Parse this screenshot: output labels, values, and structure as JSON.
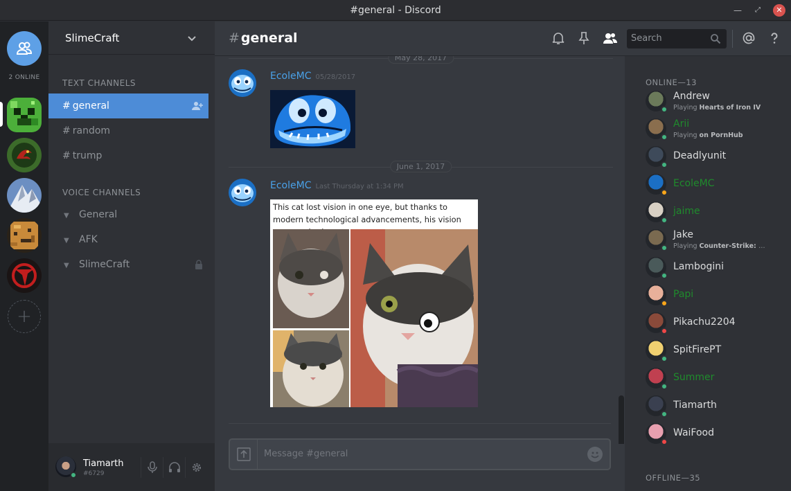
{
  "window": {
    "title": "#general - Discord"
  },
  "rail": {
    "online_label": "2 ONLINE",
    "guilds": [
      "SlimeCraft",
      "dragon-server",
      "mountain-server",
      "cookie-server",
      "red-server"
    ]
  },
  "guild": {
    "name": "SlimeCraft"
  },
  "text_category": "TEXT CHANNELS",
  "text_channels": [
    {
      "label": "general"
    },
    {
      "label": "random"
    },
    {
      "label": "trump"
    }
  ],
  "voice_category": "VOICE CHANNELS",
  "voice_channels": [
    {
      "label": "General"
    },
    {
      "label": "AFK"
    },
    {
      "label": "SlimeCraft"
    }
  ],
  "user": {
    "name": "Tiamarth",
    "tag": "#6729"
  },
  "chat": {
    "channel": "general",
    "search_placeholder": "Search",
    "divider_top": "May 28, 2017",
    "divider_mid": "June 1, 2017",
    "messages": [
      {
        "author": "EcoleMC",
        "time": "05/28/2017"
      },
      {
        "author": "EcoleMC",
        "time": "Last Thursday at 1:34 PM",
        "caption": "This cat lost vision in one eye, but thanks to modern technological advancements, his vision was repaired."
      }
    ],
    "composer_placeholder": "Message #general"
  },
  "members": {
    "online_label": "ONLINE—13",
    "offline_label": "OFFLINE—35",
    "list": [
      {
        "name": "Andrew",
        "playing_prefix": "Playing",
        "playing": "Hearts of Iron IV",
        "color": "#dcddde",
        "status": "#43b581"
      },
      {
        "name": "Arii",
        "playing_prefix": "Playing",
        "playing": "on PornHub",
        "color": "#1f8b2c",
        "status": "#43b581"
      },
      {
        "name": "Deadlyunit",
        "color": "#dcddde",
        "status": "#43b581"
      },
      {
        "name": "EcoleMC",
        "color": "#1f8b2c",
        "status": "#faa61a"
      },
      {
        "name": "jaime",
        "color": "#1f8b2c",
        "status": "#43b581"
      },
      {
        "name": "Jake",
        "playing_prefix": "Playing",
        "playing": "Counter-Strike: Glo...",
        "color": "#dcddde",
        "status": "#43b581"
      },
      {
        "name": "Lambogini",
        "color": "#dcddde",
        "status": "#43b581"
      },
      {
        "name": "Papi",
        "color": "#1f8b2c",
        "status": "#faa61a"
      },
      {
        "name": "Pikachu2204",
        "color": "#dcddde",
        "status": "#f04747"
      },
      {
        "name": "SpitFirePT",
        "color": "#dcddde",
        "status": "#43b581"
      },
      {
        "name": "Summer",
        "color": "#1f8b2c",
        "status": "#43b581"
      },
      {
        "name": "Tiamarth",
        "color": "#dcddde",
        "status": "#43b581"
      },
      {
        "name": "WaiFood",
        "color": "#dcddde",
        "status": "#f04747"
      }
    ]
  },
  "colors": {
    "accent": "#4d8cd7",
    "link": "#4aa1e8",
    "role_green": "#1f8b2c"
  }
}
